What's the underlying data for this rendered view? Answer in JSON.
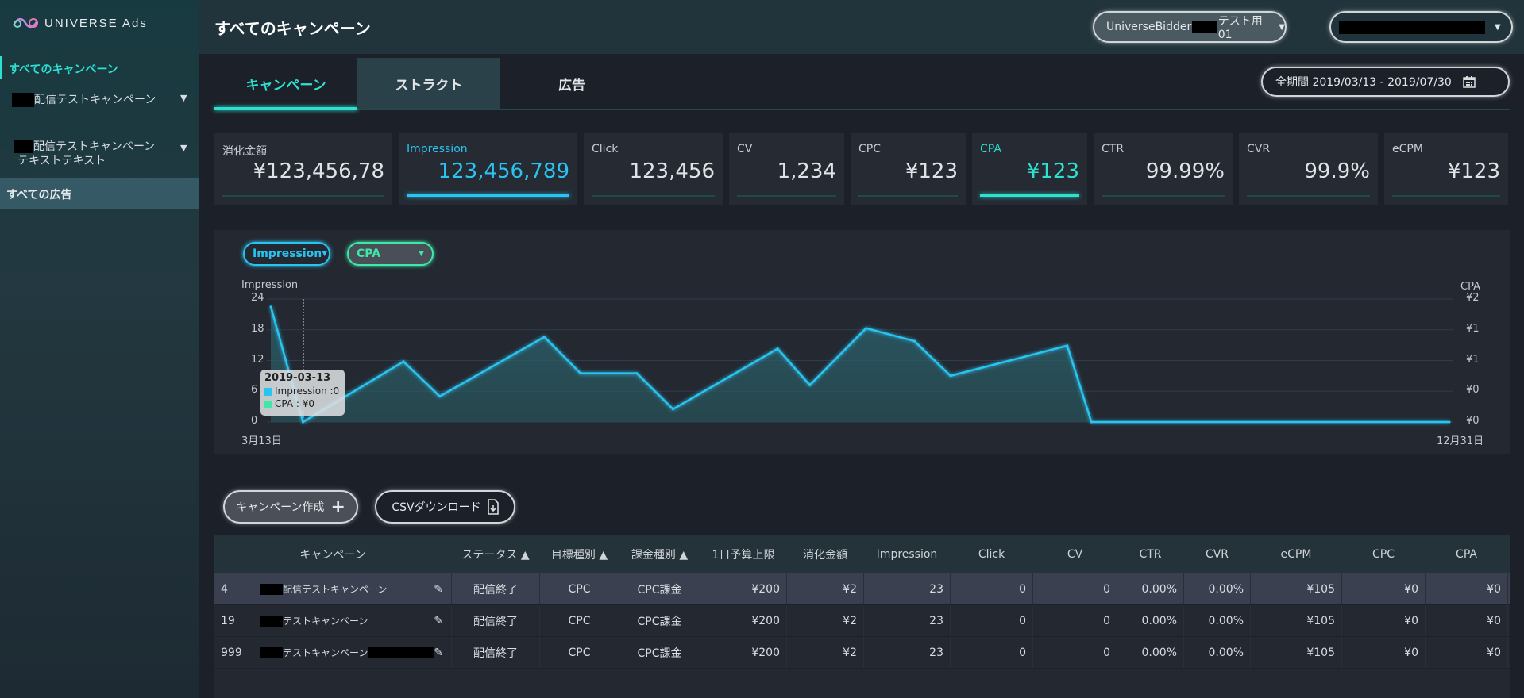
{
  "app": {
    "logo_text": "UNIVERSE Ads",
    "page_title": "すべてのキャンペーン"
  },
  "sidebar": {
    "items": [
      {
        "label": "すべてのキャンペーン",
        "active": true
      },
      {
        "label": "配信テストキャンペーン",
        "expandable": true
      },
      {
        "label": "配信テストキャンペーン",
        "label2": "テキストテキスト",
        "expandable": true
      },
      {
        "label": "すべての広告",
        "highlighted": true
      }
    ]
  },
  "header": {
    "account_select": {
      "prefix": "UniverseBidder",
      "suffix": "テスト用01"
    },
    "second_select": {
      "value": ""
    }
  },
  "tabs": [
    {
      "label": "キャンペーン",
      "active": true
    },
    {
      "label": "ストラクト"
    },
    {
      "label": "広告"
    }
  ],
  "date_range": {
    "label": "全期間 2019/03/13 - 2019/07/30",
    "icon": "calendar-icon"
  },
  "metrics": [
    {
      "label": "消化金額",
      "value": "¥123,456,78"
    },
    {
      "label": "Impression",
      "value": "123,456,789",
      "accent": "#29c4f0"
    },
    {
      "label": "Click",
      "value": "123,456"
    },
    {
      "label": "CV",
      "value": "1,234"
    },
    {
      "label": "CPC",
      "value": "¥123"
    },
    {
      "label": "CPA",
      "value": "¥123",
      "accent": "#2de0d0"
    },
    {
      "label": "CTR",
      "value": "99.99%"
    },
    {
      "label": "CVR",
      "value": "99.9%"
    },
    {
      "label": "eCPM",
      "value": "¥123"
    }
  ],
  "chart_controls": {
    "left_metric": "Impression",
    "right_metric": "CPA"
  },
  "chart_data": {
    "type": "area",
    "x": [
      "2019-03-13",
      "2019-03-21",
      "2019-04-15",
      "2019-04-24",
      "2019-05-20",
      "2019-05-29",
      "2019-06-12",
      "2019-06-21",
      "2019-07-17",
      "2019-07-25",
      "2019-08-08",
      "2019-08-20",
      "2019-08-29",
      "2019-09-27",
      "2019-10-03",
      "2019-12-31"
    ],
    "series": [
      {
        "name": "Impression",
        "axis": "left",
        "color": "#29c4f0",
        "values": [
          22.5,
          0,
          11.8,
          5,
          16.6,
          9.5,
          9.5,
          2.5,
          14.3,
          7.2,
          18.3,
          15.8,
          9,
          14.9,
          0,
          0
        ]
      },
      {
        "name": "CPA",
        "axis": "right",
        "color": "#2de0d0",
        "values": [
          0,
          0,
          0,
          0,
          0,
          0,
          0,
          0,
          0,
          0,
          0,
          0,
          0,
          0,
          0,
          0
        ]
      }
    ],
    "ylabel_left": "Impression",
    "ylabel_right": "CPA",
    "ylim_left": [
      0,
      24
    ],
    "yticks_left": [
      "0",
      "6",
      "12",
      "18",
      "24"
    ],
    "yticks_right": [
      "¥0",
      "¥0",
      "¥1",
      "¥1",
      "¥2"
    ],
    "xtick_labels": [
      "3月13日",
      "12月31日"
    ],
    "grid": true,
    "tooltip": {
      "date": "2019-03-13",
      "lines": [
        "Impression :0",
        "CPA : ¥0"
      ]
    }
  },
  "actions": {
    "create": "キャンペーン作成",
    "csv": "CSVダウンロード"
  },
  "table": {
    "headers": [
      "キャンペーン",
      "ステータス ▲",
      "目標種別 ▲",
      "課金種別 ▲",
      "1日予算上限",
      "消化金額",
      "Impression",
      "Click",
      "CV",
      "CTR",
      "CVR",
      "eCPM",
      "CPC",
      "CPA"
    ],
    "rows": [
      {
        "id": "4",
        "name": "配信テストキャンペーン",
        "cells": [
          "配信終了",
          "CPC",
          "CPC課金",
          "¥200",
          "¥2",
          "23",
          "0",
          "0",
          "0.00%",
          "0.00%",
          "¥105",
          "¥0",
          "¥0"
        ]
      },
      {
        "id": "19",
        "name": "テストキャンペーン",
        "cells": [
          "配信終了",
          "CPC",
          "CPC課金",
          "¥200",
          "¥2",
          "23",
          "0",
          "0",
          "0.00%",
          "0.00%",
          "¥105",
          "¥0",
          "¥0"
        ]
      },
      {
        "id": "999",
        "name": "テストキャンペーン",
        "cells": [
          "配信終了",
          "CPC",
          "CPC課金",
          "¥200",
          "¥2",
          "23",
          "0",
          "0",
          "0.00%",
          "0.00%",
          "¥105",
          "¥0",
          "¥0"
        ]
      }
    ]
  }
}
